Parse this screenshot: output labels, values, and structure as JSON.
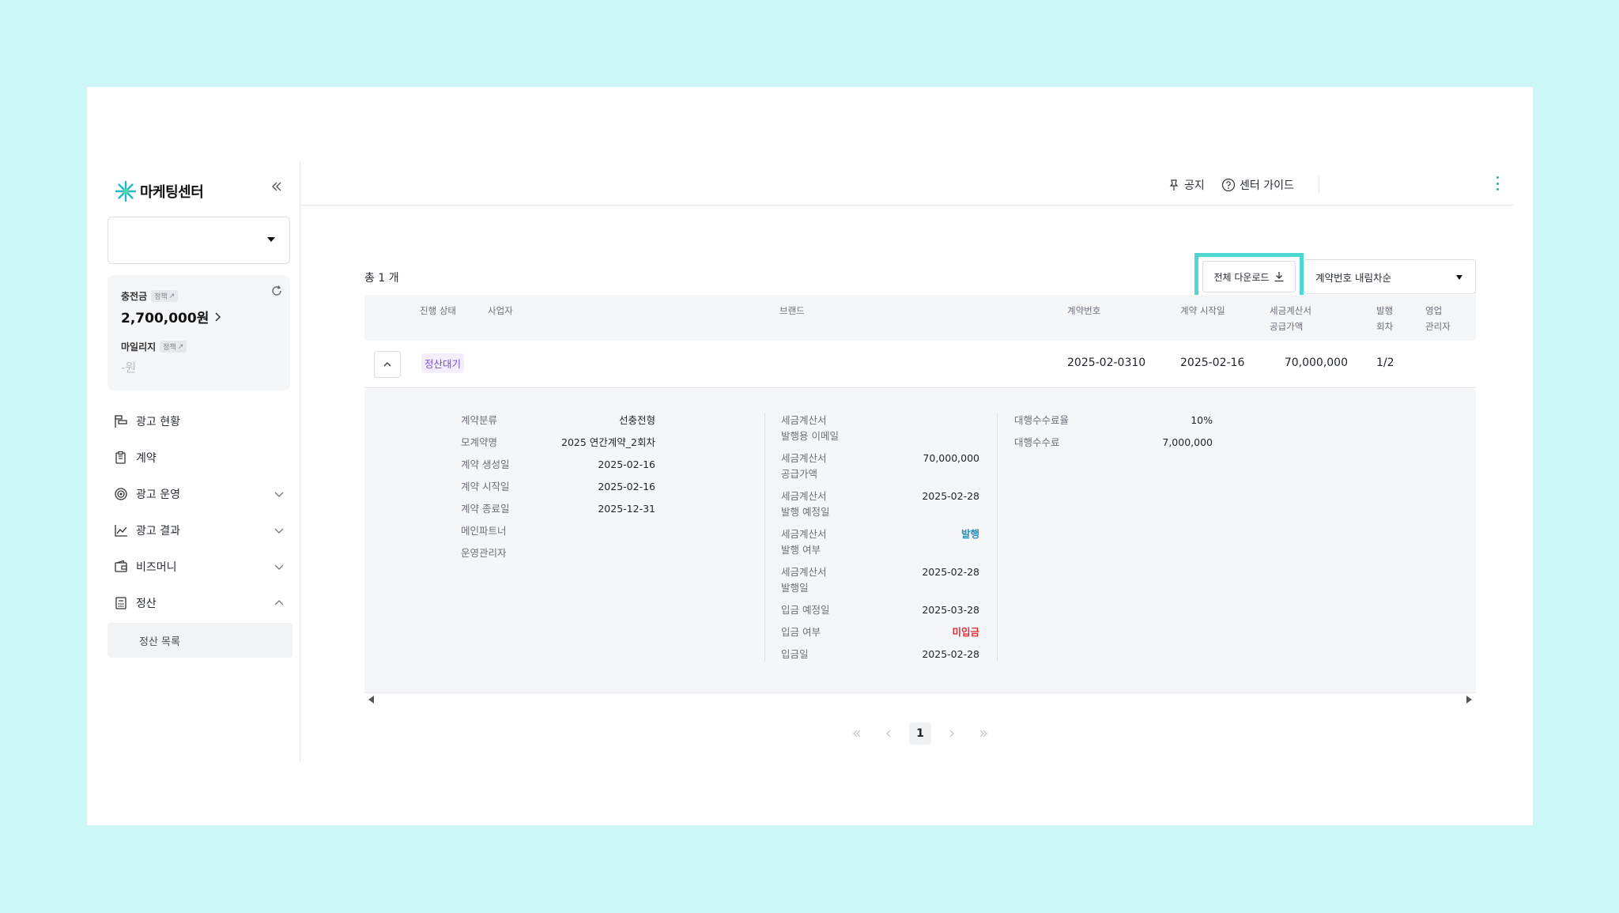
{
  "app": {
    "logo_text": "마케팅센터"
  },
  "header": {
    "notice_label": "공지",
    "guide_label": "센터 가이드"
  },
  "wallet": {
    "charge_label": "충전금",
    "charge_policy": "정책",
    "charge_value": "2,700,000원",
    "mileage_label": "마일리지",
    "mileage_policy": "정책",
    "mileage_value": "-원"
  },
  "sidebar": {
    "items": [
      {
        "label": "광고 현황"
      },
      {
        "label": "계약"
      },
      {
        "label": "광고 운영"
      },
      {
        "label": "광고 결과"
      },
      {
        "label": "비즈머니"
      },
      {
        "label": "정산"
      }
    ],
    "submenu": {
      "label": "정산 목록"
    }
  },
  "toolbar": {
    "total": "총 1 개",
    "download_label": "전체 다운로드",
    "sort_value": "계약번호 내림차순"
  },
  "table": {
    "headers": {
      "status": "진행 상태",
      "business": "사업자",
      "brand": "브랜드",
      "contract_no": "계약번호",
      "start_date": "계약 시작일",
      "supply_amount_1": "세금계산서",
      "supply_amount_2": "공급가액",
      "issue_round_1": "발행",
      "issue_round_2": "회차",
      "sales_manager_1": "영업",
      "sales_manager_2": "관리자"
    },
    "row": {
      "status": "정산대기",
      "contract_no": "2025-02-0310",
      "start_date": "2025-02-16",
      "supply_amount": "70,000,000",
      "issue_round": "1/2"
    }
  },
  "detail": {
    "col1": [
      {
        "k": "계약분류",
        "v": "선충전형"
      },
      {
        "k": "모계약명",
        "v": "2025 연간계약_2회차"
      },
      {
        "k": "계약 생성일",
        "v": "2025-02-16"
      },
      {
        "k": "계약 시작일",
        "v": "2025-02-16"
      },
      {
        "k": "계약 종료일",
        "v": "2025-12-31"
      },
      {
        "k": "메인파트너",
        "v": ""
      },
      {
        "k": "운영관리자",
        "v": ""
      }
    ],
    "col2": {
      "email_k1": "세금계산서",
      "email_k2": "발행용 이메일",
      "supply_k1": "세금계산서",
      "supply_k2": "공급가액",
      "supply_v": "70,000,000",
      "plan_k1": "세금계산서",
      "plan_k2": "발행 예정일",
      "plan_v": "2025-02-28",
      "issued_k1": "세금계산서",
      "issued_k2": "발행 여부",
      "issued_v": "발행",
      "issue_date_k1": "세금계산서",
      "issue_date_k2": "발행일",
      "issue_date_v": "2025-02-28",
      "deposit_plan_k": "입금 예정일",
      "deposit_plan_v": "2025-03-28",
      "deposit_k": "입금 여부",
      "deposit_v": "미입금",
      "deposit_date_k": "입금일",
      "deposit_date_v": "2025-02-28"
    },
    "col3": [
      {
        "k": "대행수수료율",
        "v": "10%"
      },
      {
        "k": "대행수수료",
        "v": "7,000,000"
      }
    ]
  },
  "pagination": {
    "current": "1"
  },
  "colors": {
    "accent": "#1ab8ae",
    "badge_bg": "#f3eefe",
    "badge_fg": "#7b4fd8",
    "issued": "#2d8fb8",
    "unpaid": "#e0323c",
    "highlight": "#4fd7d3"
  }
}
